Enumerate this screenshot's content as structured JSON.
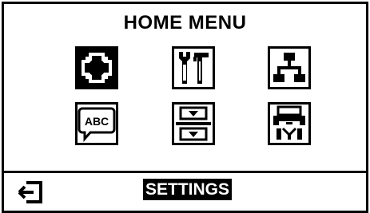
{
  "screen": {
    "title": "HOME MENU",
    "selected_label": "SETTINGS"
  },
  "menu": {
    "items": [
      {
        "icon": "settings-gear-icon",
        "selected": true
      },
      {
        "icon": "tools-icon",
        "selected": false
      },
      {
        "icon": "network-icon",
        "selected": false
      },
      {
        "icon": "language-abc-icon",
        "selected": false
      },
      {
        "icon": "sensor-icon",
        "selected": false
      },
      {
        "icon": "printer-ports-icon",
        "selected": false
      }
    ]
  },
  "nav": {
    "back_icon": "exit-arrow-icon"
  }
}
